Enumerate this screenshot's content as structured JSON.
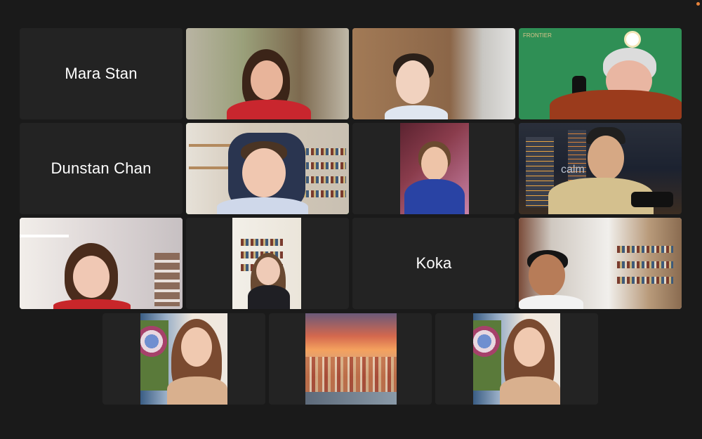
{
  "participants": {
    "mara": {
      "name": "Mara Stan"
    },
    "dunstan": {
      "name": "Dunstan Chan"
    },
    "koka": {
      "name": "Koka"
    }
  },
  "overlays": {
    "bg_text": "calm",
    "logo_text": "FRONTIER"
  },
  "colors": {
    "background": "#1a1a1a",
    "tile": "#232323",
    "speaker_border": "#3fbf3f",
    "green_screen": "#2f8f55"
  }
}
